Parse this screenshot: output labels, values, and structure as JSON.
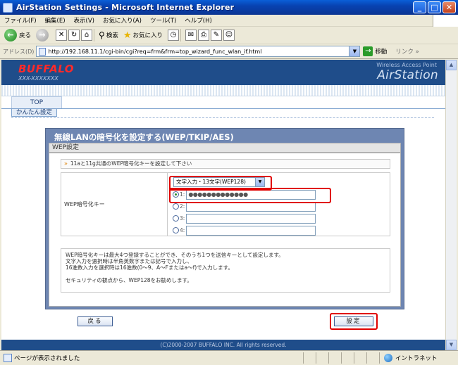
{
  "window": {
    "title": "AirStation Settings - Microsoft Internet Explorer",
    "buttons": {
      "minimize": "_",
      "maximize": "□",
      "close": "✕"
    }
  },
  "menubar": {
    "items": [
      "ファイル(F)",
      "編集(E)",
      "表示(V)",
      "お気に入り(A)",
      "ツール(T)",
      "ヘルプ(H)"
    ]
  },
  "toolbar": {
    "back": "戻る",
    "search": "検索",
    "favorites": "お気に入り"
  },
  "address": {
    "label": "アドレス(D)",
    "url": "http://192.168.11.1/cgi-bin/cgi?req=frm&frm=top_wizard_func_wlan_if.html",
    "go": "移動",
    "links": "リンク »"
  },
  "brand": {
    "logo": "BUFFALO",
    "model": "XXX-XXXXXXX",
    "tagline": "Wireless Access Point",
    "product": "AirStation"
  },
  "nav": {
    "top_tab": "TOP",
    "active_sub": "かんたん設定"
  },
  "panel": {
    "title": "無線LANの暗号化を設定する(WEP/TKIP/AES)",
    "section": "WEP設定",
    "instruction": "11aと11g共通のWEP暗号化キーを設定して下さい",
    "key_label": "WEP暗号化キー",
    "key_type": "文字入力・13文字(WEP128)",
    "keys": [
      {
        "label": "1:",
        "value": "●●●●●●●●●●●●●",
        "selected": true
      },
      {
        "label": "2:",
        "value": "",
        "selected": false
      },
      {
        "label": "3:",
        "value": "",
        "selected": false
      },
      {
        "label": "4:",
        "value": "",
        "selected": false
      }
    ],
    "notes": [
      "WEP暗号化キーは最大4つ登録することができ、そのうち1つを送信キーとして設定します。",
      "文字入力を選択時は半角英数字または記号で入力し、",
      "16進数入力を選択時は16進数(0〜9、A〜Fまたはa〜f)で入力します。",
      "セキュリティの観点から、WEP128をお勧めします。"
    ]
  },
  "buttons": {
    "back": "戻る",
    "apply": "設定"
  },
  "footer": "(C)2000-2007 BUFFALO INC. All rights reserved.",
  "status": {
    "message": "ページが表示されました",
    "zone": "イントラネット"
  },
  "colors": {
    "highlight": "#e00000",
    "brand_bar": "#1f4d8a",
    "panel": "#6e86b2"
  }
}
